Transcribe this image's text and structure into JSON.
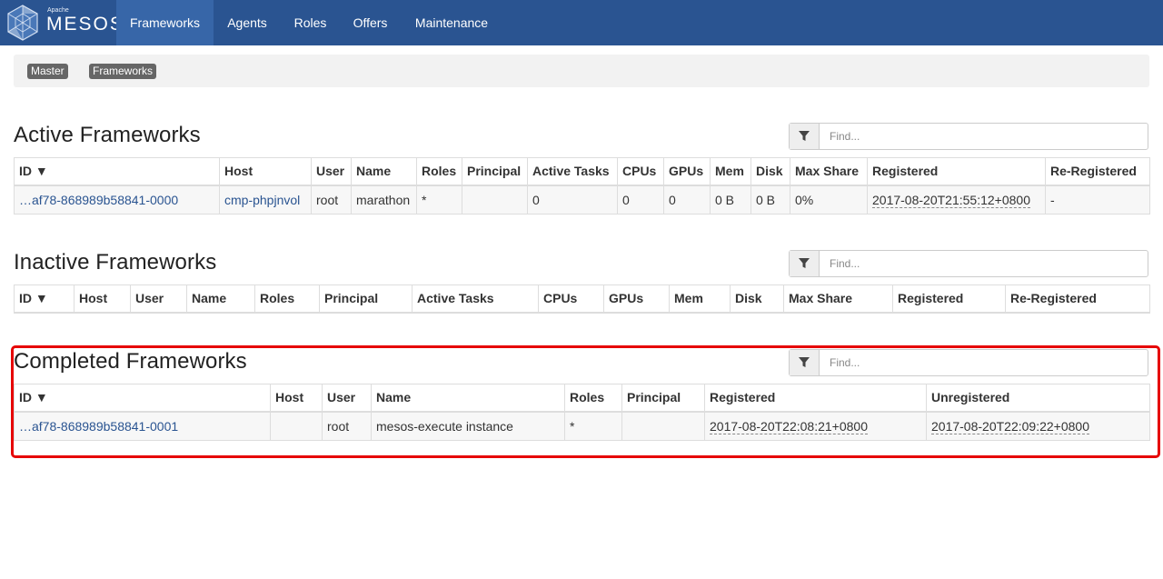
{
  "navbar": {
    "brand_small": "Apache",
    "brand_name": "MESOS",
    "items": [
      "Frameworks",
      "Agents",
      "Roles",
      "Offers",
      "Maintenance"
    ],
    "active_item": "Frameworks",
    "background": "#2a5491"
  },
  "breadcrumb": {
    "items": [
      "Master",
      "Frameworks"
    ],
    "separator": "/"
  },
  "filter_placeholder": "Find...",
  "active": {
    "title": "Active Frameworks",
    "headers": [
      "ID ▼",
      "Host",
      "User",
      "Name",
      "Roles",
      "Principal",
      "Active Tasks",
      "CPUs",
      "GPUs",
      "Mem",
      "Disk",
      "Max Share",
      "Registered",
      "Re-Registered"
    ],
    "rows": [
      [
        "…af78-868989b58841-0000",
        "cmp-phpjnvol",
        "root",
        "marathon",
        "*",
        "",
        "0",
        "0",
        "0",
        "0 B",
        "0 B",
        "0%",
        "2017-08-20T21:55:12+0800",
        "-"
      ]
    ]
  },
  "inactive": {
    "title": "Inactive Frameworks",
    "headers": [
      "ID ▼",
      "Host",
      "User",
      "Name",
      "Roles",
      "Principal",
      "Active Tasks",
      "CPUs",
      "GPUs",
      "Mem",
      "Disk",
      "Max Share",
      "Registered",
      "Re-Registered"
    ]
  },
  "completed": {
    "title": "Completed Frameworks",
    "headers": [
      "ID ▼",
      "Host",
      "User",
      "Name",
      "Roles",
      "Principal",
      "Registered",
      "Unregistered"
    ],
    "rows": [
      [
        "…af78-868989b58841-0001",
        "",
        "root",
        "mesos-execute instance",
        "*",
        "",
        "2017-08-20T22:08:21+0800",
        "2017-08-20T22:09:22+0800"
      ]
    ],
    "highlight_color": "#e60000"
  },
  "icons": {
    "filter": "filter-icon",
    "logo": "mesos-logo-icon"
  }
}
